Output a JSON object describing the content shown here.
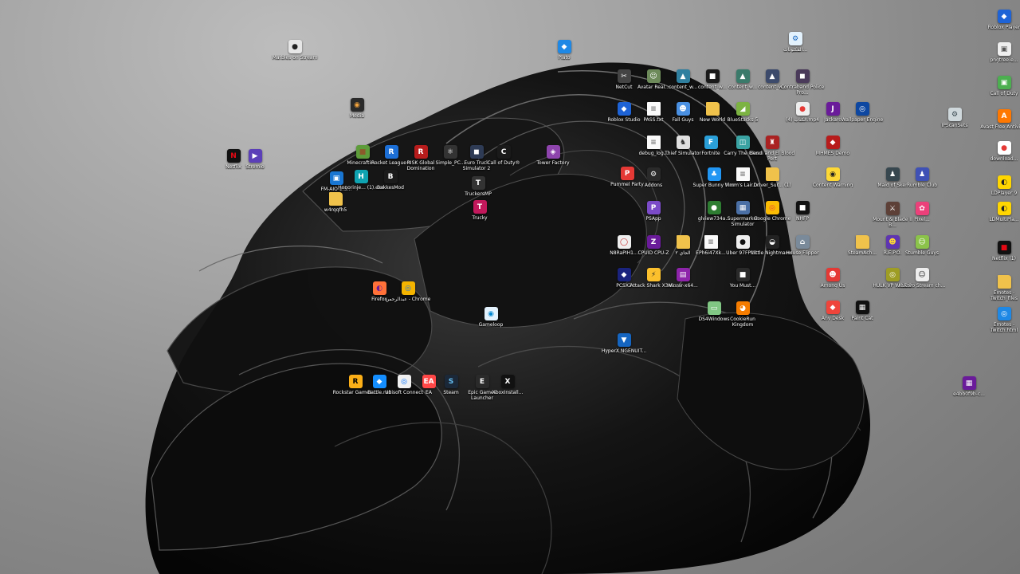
{
  "desktop": {
    "icons": [
      {
        "label": "Marbles on Stream",
        "glyph": "●",
        "color": "#e6e6e6",
        "fg": "#222222"
      },
      {
        "label": "Plato",
        "glyph": "◆",
        "color": "#1e88e5",
        "fg": "#ffffff"
      },
      {
        "label": "Media",
        "glyph": "◉",
        "color": "#2a2a2a",
        "fg": "#f2a23c"
      },
      {
        "label": "Netflix",
        "glyph": "N",
        "color": "#111111",
        "fg": "#e50914"
      },
      {
        "label": "Stremio",
        "glyph": "▶",
        "color": "#5b3fb8",
        "fg": "#ffffff"
      },
      {
        "label": "Minecraftin...",
        "glyph": "■",
        "color": "#5d9c3a",
        "fg": "#8b5a2b"
      },
      {
        "label": "Rocket League®",
        "glyph": "R",
        "color": "#1c6fd6",
        "fg": "#ffffff"
      },
      {
        "label": "RISK Global Domination",
        "glyph": "R",
        "color": "#b71c1c",
        "fg": "#ffffff"
      },
      {
        "label": "Simple_PC...",
        "glyph": "⚛",
        "color": "#333333",
        "fg": "#ffffff"
      },
      {
        "label": "Euro Truck Simulator 2",
        "glyph": "◼",
        "color": "#2e3b55",
        "fg": "#ffffff"
      },
      {
        "label": "Call of Duty®",
        "glyph": "C",
        "color": "#1a1a1a",
        "fg": "#ffffff"
      },
      {
        "label": "Tower Factory",
        "glyph": "◈",
        "color": "#8e44ad",
        "fg": "#ffffff"
      },
      {
        "label": "FM-AIO-2.5...",
        "glyph": "▣",
        "color": "#1976d2",
        "fg": "#ffffff"
      },
      {
        "label": "Honorinje... (1).exe",
        "glyph": "H",
        "color": "#0fa3b1",
        "fg": "#ffffff"
      },
      {
        "label": "BakkesMod",
        "glyph": "B",
        "color": "#1b1b1b",
        "fg": "#ffffff"
      },
      {
        "label": "TruckersMP",
        "glyph": "T",
        "color": "#333333",
        "fg": "#ffffff"
      },
      {
        "label": "w4rqqfh5",
        "glyph": "",
        "color": "#f0c24b",
        "fg": "#ffffff"
      },
      {
        "label": "Trucky",
        "glyph": "T",
        "color": "#c2185b",
        "fg": "#ffffff"
      },
      {
        "label": "Firefox",
        "glyph": "◐",
        "color": "#ff7139",
        "fg": "#6a1b9a"
      },
      {
        "label": "عبدالرحمن - Chrome",
        "glyph": "◎",
        "color": "#f4b400",
        "fg": "#1a73e8"
      },
      {
        "label": "Gameloop",
        "glyph": "◉",
        "color": "#e3f2fd",
        "fg": "#0288d1"
      },
      {
        "label": "Rockstar Games ...",
        "glyph": "R",
        "color": "#fcaf17",
        "fg": "#000000"
      },
      {
        "label": "Battle.net",
        "glyph": "◆",
        "color": "#148eff",
        "fg": "#ffffff"
      },
      {
        "label": "Ubisoft Connect",
        "glyph": "◎",
        "color": "#f0f0f0",
        "fg": "#0070ff"
      },
      {
        "label": "EA",
        "glyph": "EA",
        "color": "#ff4747",
        "fg": "#ffffff"
      },
      {
        "label": "Steam",
        "glyph": "S",
        "color": "#1b2838",
        "fg": "#66c0f4"
      },
      {
        "label": "Epic Games Launcher",
        "glyph": "E",
        "color": "#2a2a2a",
        "fg": "#ffffff"
      },
      {
        "label": "XboxInstall...",
        "glyph": "X",
        "color": "#111111",
        "fg": "#ffffff"
      },
      {
        "label": "NetCut",
        "glyph": "✂",
        "color": "#444444",
        "fg": "#ffffff"
      },
      {
        "label": "Avatar Real...",
        "glyph": "☺",
        "color": "#6d8a5a",
        "fg": "#ffffff"
      },
      {
        "label": "content_w...",
        "glyph": "▲",
        "color": "#2f7f9f",
        "fg": "#ffffff"
      },
      {
        "label": "content_w...",
        "glyph": "■",
        "color": "#1a1a1a",
        "fg": "#ffffff"
      },
      {
        "label": "content_w...",
        "glyph": "▲",
        "color": "#3a7a6a",
        "fg": "#ffffff"
      },
      {
        "label": "content_w...",
        "glyph": "▲",
        "color": "#3c4a6b",
        "fg": "#ffffff"
      },
      {
        "label": "Contraband Police Pro...",
        "glyph": "◼",
        "color": "#4a3a5a",
        "fg": "#ffffff"
      },
      {
        "label": "Roblox Studio",
        "glyph": "◆",
        "color": "#1e63d6",
        "fg": "#ffffff"
      },
      {
        "label": "PASS.txt",
        "glyph": "≡",
        "color": "#fafafa",
        "fg": "#777777"
      },
      {
        "label": "Fall Guys",
        "glyph": "☻",
        "color": "#4a90e2",
        "fg": "#ffffff"
      },
      {
        "label": "New World",
        "glyph": "",
        "color": "#f0c24b",
        "fg": "#ffffff"
      },
      {
        "label": "BlueStacks 5",
        "glyph": "◢",
        "color": "#7cb342",
        "fg": "#ffffff"
      },
      {
        "label": "debug_log...",
        "glyph": "≡",
        "color": "#fafafa",
        "fg": "#777777"
      },
      {
        "label": "Thief Simulator",
        "glyph": "♞",
        "color": "#e0e0e0",
        "fg": "#333333"
      },
      {
        "label": "Fortnite",
        "glyph": "F",
        "color": "#2a9fd8",
        "fg": "#ffffff"
      },
      {
        "label": "Carry The Glass",
        "glyph": "◫",
        "color": "#3aa3a3",
        "fg": "#ffffff"
      },
      {
        "label": "Bendi and El Blood Pert",
        "glyph": "♜",
        "color": "#aa2222",
        "fg": "#ffffff"
      },
      {
        "label": "Pummel Party",
        "glyph": "P",
        "color": "#e53935",
        "fg": "#ffffff"
      },
      {
        "label": "Addons",
        "glyph": "⚙",
        "color": "#2a2a2a",
        "fg": "#ffffff"
      },
      {
        "label": "Super Bunny Man",
        "glyph": "♣",
        "color": "#2196f3",
        "fg": "#ffffff"
      },
      {
        "label": "Vimm's Lair.txt",
        "glyph": "≡",
        "color": "#fafafa",
        "fg": "#777777"
      },
      {
        "label": "Driver_Sur... (1)",
        "glyph": "",
        "color": "#f0c24b",
        "fg": "#ffffff"
      },
      {
        "label": "PSApp",
        "glyph": "P",
        "color": "#7b4bc8",
        "fg": "#ffffff"
      },
      {
        "label": "glview734a...",
        "glyph": "●",
        "color": "#2e7d32",
        "fg": "#ffffff"
      },
      {
        "label": "Supermarket Simulator",
        "glyph": "▦",
        "color": "#4a6fa5",
        "fg": "#ffffff"
      },
      {
        "label": "Google Chrome",
        "glyph": "◎",
        "color": "#fbbc05",
        "fg": "#ea4335"
      },
      {
        "label": "NHFP",
        "glyph": "■",
        "color": "#111111",
        "fg": "#ffffff"
      },
      {
        "label": "N8RaPIH1...",
        "glyph": "◯",
        "color": "#eeeeee",
        "fg": "#c62828"
      },
      {
        "label": "CPUID CPU-Z",
        "glyph": "Z",
        "color": "#6a1b9a",
        "fg": "#ffffff"
      },
      {
        "label": "الجاي ٢",
        "glyph": "",
        "color": "#f0c24b",
        "fg": "#ffffff"
      },
      {
        "label": "EPh6i47Xk...",
        "glyph": "≡",
        "color": "#fafafa",
        "fg": "#777777"
      },
      {
        "label": "Uber 97FPM...",
        "glyph": "●",
        "color": "#eeeeee",
        "fg": "#111111"
      },
      {
        "label": "Little Nightmares",
        "glyph": "◒",
        "color": "#222222",
        "fg": "#ffffff"
      },
      {
        "label": "House Flipper",
        "glyph": "⌂",
        "color": "#7a8a9a",
        "fg": "#ffffff"
      },
      {
        "label": "PCSX2",
        "glyph": "◆",
        "color": "#1a237e",
        "fg": "#ffffff"
      },
      {
        "label": "Attack Shark X3M...",
        "glyph": "⚡",
        "color": "#fbc02d",
        "fg": "#222222"
      },
      {
        "label": "winrar-x64...",
        "glyph": "▤",
        "color": "#8e24aa",
        "fg": "#ffffff"
      },
      {
        "label": "You Must...",
        "glyph": "■",
        "color": "#2a2a2a",
        "fg": "#ffffff"
      },
      {
        "label": "DS4Windows",
        "glyph": "▭",
        "color": "#81c784",
        "fg": "#ffffff"
      },
      {
        "label": "CookieRun Kingdom",
        "glyph": "◕",
        "color": "#f57c00",
        "fg": "#ffffff"
      },
      {
        "label": "HyperX NGENUIT...",
        "glyph": "▼",
        "color": "#1565c0",
        "fg": "#ffffff"
      },
      {
        "label": "المكتوبات...",
        "glyph": "⚙",
        "color": "#e3f2fd",
        "fg": "#1565c0"
      },
      {
        "label": "Roblox Player",
        "glyph": "◆",
        "color": "#1e63d6",
        "fg": "#ffffff"
      },
      {
        "label": "pngtree-e...",
        "glyph": "▣",
        "color": "#eeeeee",
        "fg": "#555555"
      },
      {
        "label": "Call of Duty",
        "glyph": "▣",
        "color": "#4caf50",
        "fg": "#ffffff"
      },
      {
        "label": "Avast Free Antivirus",
        "glyph": "A",
        "color": "#ff7800",
        "fg": "#ffffff"
      },
      {
        "label": "download...",
        "glyph": "●",
        "color": "#ffffff",
        "fg": "#e53935"
      },
      {
        "label": "LDPlayer 9",
        "glyph": "◐",
        "color": "#ffd600",
        "fg": "#222222"
      },
      {
        "label": "LDMultiPla...",
        "glyph": "◐",
        "color": "#ffd600",
        "fg": "#222222"
      },
      {
        "label": "Netflix (1)",
        "glyph": "■",
        "color": "#111111",
        "fg": "#e50914"
      },
      {
        "label": "Emotes - Twitch_files",
        "glyph": "",
        "color": "#f0c24b",
        "fg": "#ffffff"
      },
      {
        "label": "Emotes - Twitch.html",
        "glyph": "◎",
        "color": "#1e88e5",
        "fg": "#ffffff"
      },
      {
        "label": "IPScanSets",
        "glyph": "⚙",
        "color": "#cfd8dc",
        "fg": "#37474f"
      },
      {
        "label": "Jackaro",
        "glyph": "J",
        "color": "#6a1b9a",
        "fg": "#ffffff"
      },
      {
        "label": "Wallpaper Engine",
        "glyph": "◎",
        "color": "#0d47a1",
        "fg": "#ffffff"
      },
      {
        "label": "الكتاب (4).mp4",
        "glyph": "●",
        "color": "#eeeeee",
        "fg": "#e53935"
      },
      {
        "label": "MHMES Demo",
        "glyph": "◆",
        "color": "#b71c1c",
        "fg": "#ffffff"
      },
      {
        "label": "Content Warning",
        "glyph": "◉",
        "color": "#fdd835",
        "fg": "#222222"
      },
      {
        "label": "Maid of Sker",
        "glyph": "♟",
        "color": "#37474f",
        "fg": "#ffffff"
      },
      {
        "label": "Rumble Club",
        "glyph": "♟",
        "color": "#3f51b5",
        "fg": "#ffffff"
      },
      {
        "label": "Mount & Blade II B...",
        "glyph": "⚔",
        "color": "#5d4037",
        "fg": "#ffffff"
      },
      {
        "label": "Pixel...",
        "glyph": "✿",
        "color": "#ec407a",
        "fg": "#ffffff"
      },
      {
        "label": "SteamAch...",
        "glyph": "",
        "color": "#f0c24b",
        "fg": "#ffffff"
      },
      {
        "label": "R.E.P.O.",
        "glyph": "☻",
        "color": "#5e35b1",
        "fg": "#fdd835"
      },
      {
        "label": "Stumble Guys",
        "glyph": "☺",
        "color": "#8bc34a",
        "fg": "#ffffff"
      },
      {
        "label": "Among Us",
        "glyph": "☻",
        "color": "#e53935",
        "fg": "#ffffff"
      },
      {
        "label": "HULK VP WINDO",
        "glyph": "◎",
        "color": "#9e9d24",
        "fg": "#ffffff"
      },
      {
        "label": "Kukoro Stream ch...",
        "glyph": "☺",
        "color": "#eeeeee",
        "fg": "#222222"
      },
      {
        "label": "Any Desk",
        "glyph": "◆",
        "color": "#ef443b",
        "fg": "#ffffff"
      },
      {
        "label": "Paint Cat",
        "glyph": "▦",
        "color": "#111111",
        "fg": "#ffffff"
      },
      {
        "label": "e4bb0f9b-c...",
        "glyph": "▦",
        "color": "#6a1b9a",
        "fg": "#ffffff"
      }
    ]
  }
}
